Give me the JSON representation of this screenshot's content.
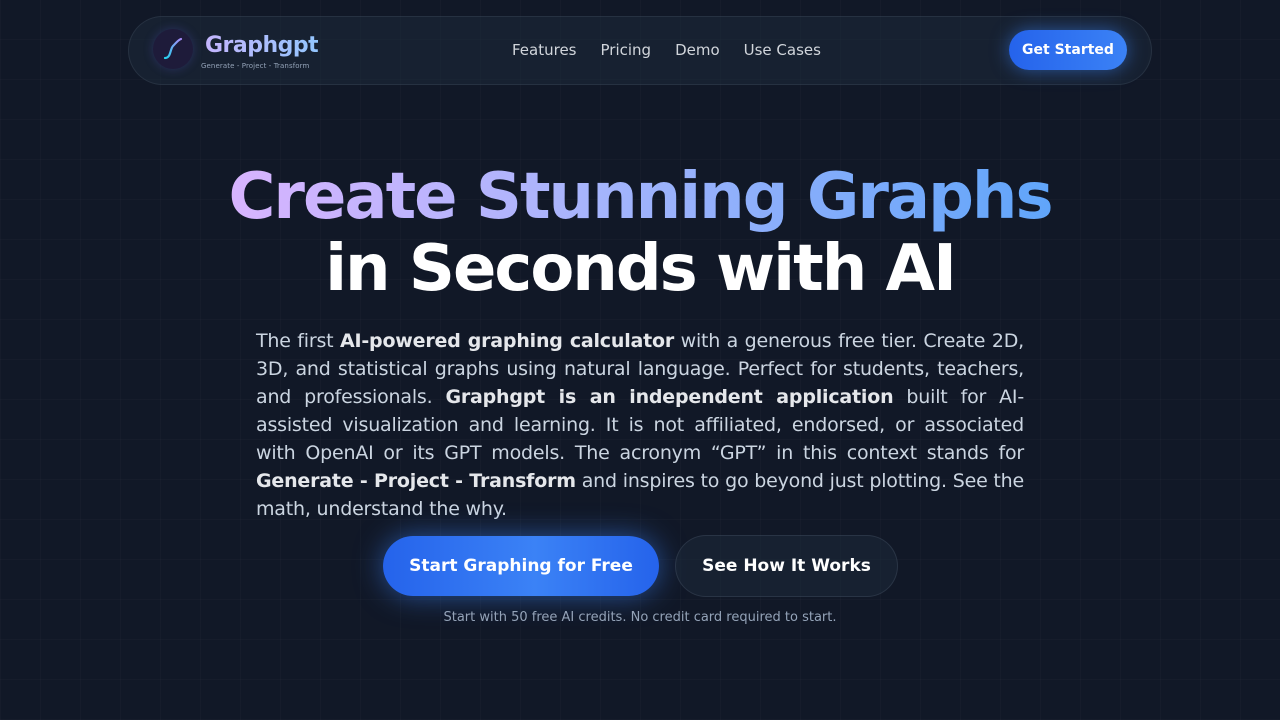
{
  "brand": {
    "name": "Graphgpt",
    "tagline": "Generate - Project - Transform",
    "icon": "graph-curve-icon"
  },
  "nav": {
    "links": [
      "Features",
      "Pricing",
      "Demo",
      "Use Cases"
    ],
    "cta_label": "Get Started"
  },
  "hero": {
    "title_line1": "Create Stunning Graphs",
    "title_line2": "in Seconds with AI",
    "description": {
      "t1": "The first ",
      "b1": "AI-powered graphing calculator",
      "t2": " with a generous free tier. Create 2D, 3D, and statistical graphs using natural language. Perfect for students, teachers, and professionals. ",
      "b2": "Graphgpt is an independent application",
      "t3": " built for AI-assisted visualization and learning. It is not affiliated, endorsed, or associated with OpenAI or its GPT models. The acronym “GPT” in this context stands for ",
      "b3": "Generate - Project - Transform",
      "t4": " and inspires to go beyond just plotting. See the math, understand the why."
    },
    "primary_button": "Start Graphing for Free",
    "secondary_button": "See How It Works",
    "note": "Start with 50 free AI credits. No credit card required to start."
  },
  "colors": {
    "background": "#111827",
    "accent": "#3b82f6",
    "gradient_start": "#d8b4fe",
    "gradient_end": "#60a5fa"
  }
}
